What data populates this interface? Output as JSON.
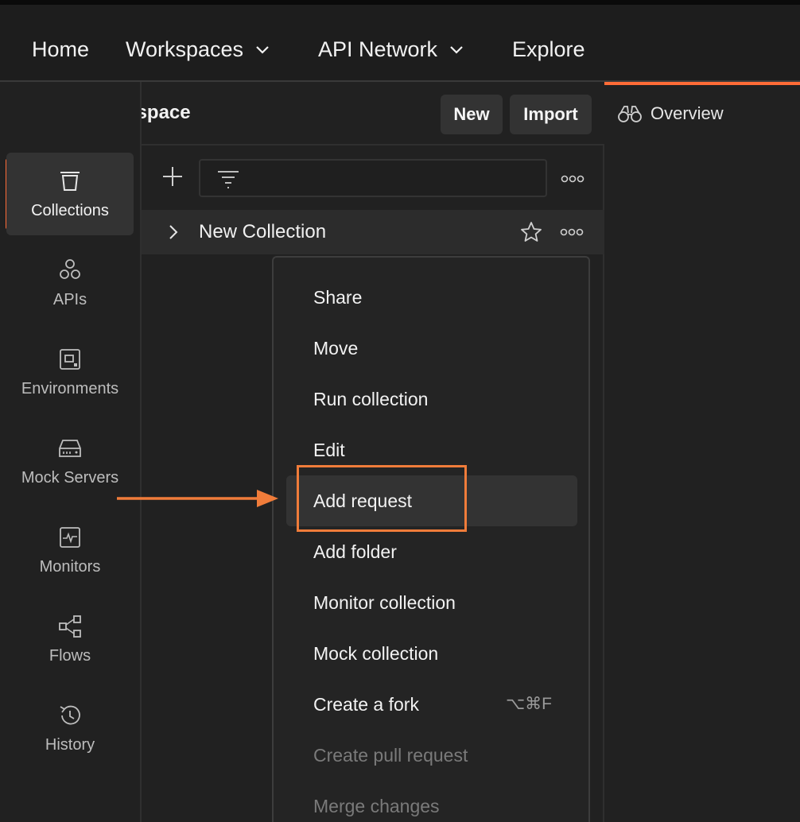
{
  "nav": {
    "home": "Home",
    "workspaces": "Workspaces",
    "api_network": "API Network",
    "explore": "Explore"
  },
  "workspace": {
    "title": "My Workspace",
    "new_label": "New",
    "import_label": "Import"
  },
  "sidebar": {
    "items": [
      {
        "label": "Collections",
        "icon": "trash-bin-icon",
        "active": true
      },
      {
        "label": "APIs",
        "icon": "hexagons-icon",
        "active": false
      },
      {
        "label": "Environments",
        "icon": "environment-icon",
        "active": false
      },
      {
        "label": "Mock Servers",
        "icon": "server-icon",
        "active": false
      },
      {
        "label": "Monitors",
        "icon": "monitor-icon",
        "active": false
      },
      {
        "label": "Flows",
        "icon": "flows-icon",
        "active": false
      },
      {
        "label": "History",
        "icon": "history-icon",
        "active": false
      }
    ]
  },
  "collections": {
    "search_value": "",
    "rows": [
      {
        "name": "New Collection"
      }
    ]
  },
  "right": {
    "overview_label": "Overview"
  },
  "context_menu": {
    "items": [
      {
        "label": "Share",
        "shortcut": "",
        "disabled": false,
        "highlighted": false
      },
      {
        "label": "Move",
        "shortcut": "",
        "disabled": false,
        "highlighted": false
      },
      {
        "label": "Run collection",
        "shortcut": "",
        "disabled": false,
        "highlighted": false
      },
      {
        "label": "Edit",
        "shortcut": "",
        "disabled": false,
        "highlighted": false
      },
      {
        "label": "Add request",
        "shortcut": "",
        "disabled": false,
        "highlighted": true
      },
      {
        "label": "Add folder",
        "shortcut": "",
        "disabled": false,
        "highlighted": false
      },
      {
        "label": "Monitor collection",
        "shortcut": "",
        "disabled": false,
        "highlighted": false
      },
      {
        "label": "Mock collection",
        "shortcut": "",
        "disabled": false,
        "highlighted": false
      },
      {
        "label": "Create a fork",
        "shortcut": "⌥⌘F",
        "disabled": false,
        "highlighted": false
      },
      {
        "label": "Create pull request",
        "shortcut": "",
        "disabled": true,
        "highlighted": false
      },
      {
        "label": "Merge changes",
        "shortcut": "",
        "disabled": true,
        "highlighted": false
      }
    ]
  },
  "colors": {
    "accent": "#ff6c37",
    "annotation": "#f07c3a",
    "background": "#212121"
  }
}
